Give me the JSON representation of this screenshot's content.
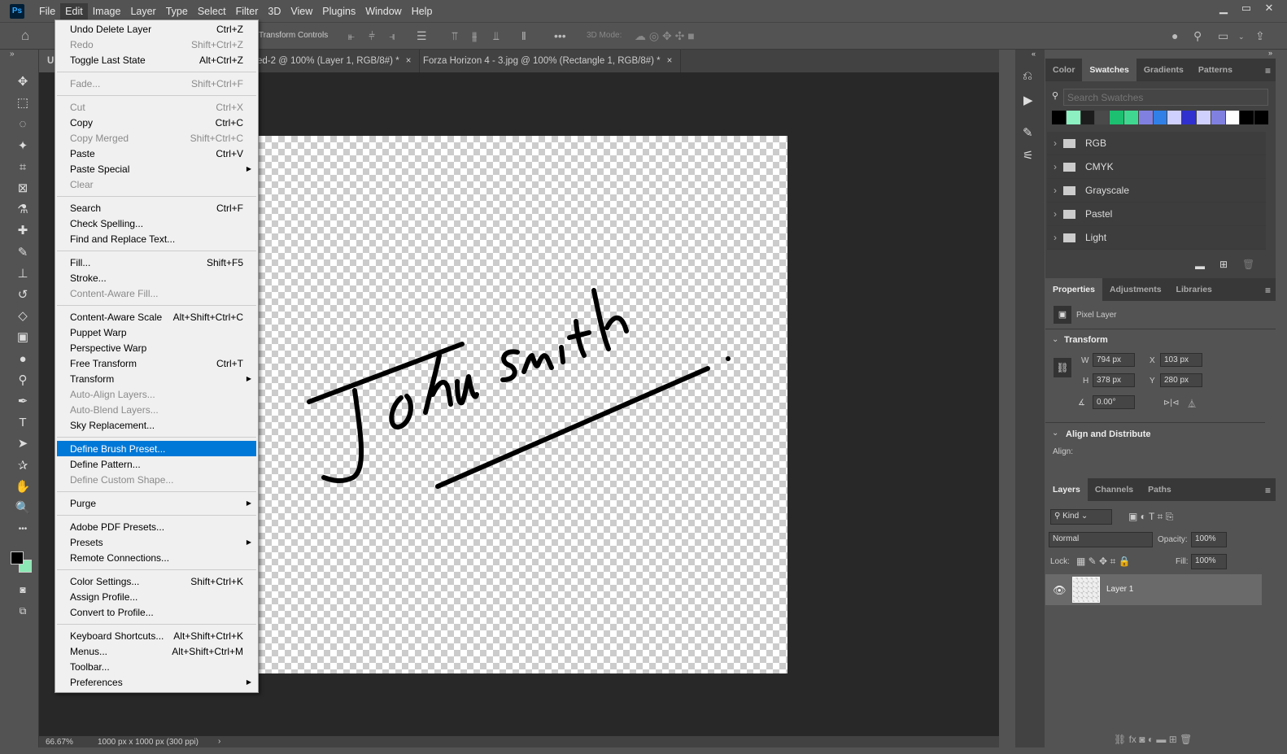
{
  "app": {
    "logo": "Ps"
  },
  "menubar": [
    "File",
    "Edit",
    "Image",
    "Layer",
    "Type",
    "Select",
    "Filter",
    "3D",
    "View",
    "Plugins",
    "Window",
    "Help"
  ],
  "active_menu": "Edit",
  "window_controls": [
    "minimize-icon",
    "maximize-icon",
    "close-icon"
  ],
  "options": {
    "transform_controls": "Transform Controls",
    "mode_3d": "3D Mode:"
  },
  "tabs": [
    {
      "label": "U",
      "partial": true
    },
    {
      "label": "ed-2 @ 100% (Layer 1, RGB/8#) *",
      "close": "×"
    },
    {
      "label": "Forza Horizon 4 - 3.jpg @ 100% (Rectangle 1, RGB/8#) *",
      "close": "×"
    }
  ],
  "edit_menu": [
    [
      {
        "label": "Undo Delete Layer",
        "shortcut": "Ctrl+Z"
      },
      {
        "label": "Redo",
        "shortcut": "Shift+Ctrl+Z",
        "disabled": true
      },
      {
        "label": "Toggle Last State",
        "shortcut": "Alt+Ctrl+Z"
      }
    ],
    [
      {
        "label": "Fade...",
        "shortcut": "Shift+Ctrl+F",
        "disabled": true
      }
    ],
    [
      {
        "label": "Cut",
        "shortcut": "Ctrl+X",
        "disabled": true
      },
      {
        "label": "Copy",
        "shortcut": "Ctrl+C"
      },
      {
        "label": "Copy Merged",
        "shortcut": "Shift+Ctrl+C",
        "disabled": true
      },
      {
        "label": "Paste",
        "shortcut": "Ctrl+V"
      },
      {
        "label": "Paste Special",
        "submenu": true
      },
      {
        "label": "Clear",
        "disabled": true
      }
    ],
    [
      {
        "label": "Search",
        "shortcut": "Ctrl+F"
      },
      {
        "label": "Check Spelling..."
      },
      {
        "label": "Find and Replace Text..."
      }
    ],
    [
      {
        "label": "Fill...",
        "shortcut": "Shift+F5"
      },
      {
        "label": "Stroke..."
      },
      {
        "label": "Content-Aware Fill...",
        "disabled": true
      }
    ],
    [
      {
        "label": "Content-Aware Scale",
        "shortcut": "Alt+Shift+Ctrl+C"
      },
      {
        "label": "Puppet Warp"
      },
      {
        "label": "Perspective Warp"
      },
      {
        "label": "Free Transform",
        "shortcut": "Ctrl+T"
      },
      {
        "label": "Transform",
        "submenu": true
      },
      {
        "label": "Auto-Align Layers...",
        "disabled": true
      },
      {
        "label": "Auto-Blend Layers...",
        "disabled": true
      },
      {
        "label": "Sky Replacement..."
      }
    ],
    [
      {
        "label": "Define Brush Preset...",
        "highlighted": true
      },
      {
        "label": "Define Pattern..."
      },
      {
        "label": "Define Custom Shape...",
        "disabled": true
      }
    ],
    [
      {
        "label": "Purge",
        "submenu": true
      }
    ],
    [
      {
        "label": "Adobe PDF Presets..."
      },
      {
        "label": "Presets",
        "submenu": true
      },
      {
        "label": "Remote Connections..."
      }
    ],
    [
      {
        "label": "Color Settings...",
        "shortcut": "Shift+Ctrl+K"
      },
      {
        "label": "Assign Profile..."
      },
      {
        "label": "Convert to Profile..."
      }
    ],
    [
      {
        "label": "Keyboard Shortcuts...",
        "shortcut": "Alt+Shift+Ctrl+K"
      },
      {
        "label": "Menus...",
        "shortcut": "Alt+Shift+Ctrl+M"
      },
      {
        "label": "Toolbar..."
      },
      {
        "label": "Preferences",
        "submenu": true
      }
    ]
  ],
  "tools": [
    "move-icon",
    "marquee-icon",
    "lasso-icon",
    "magic-wand-icon",
    "crop-icon",
    "frame-icon",
    "eyedropper-icon",
    "healing-icon",
    "brush-icon",
    "stamp-icon",
    "history-brush-icon",
    "eraser-icon",
    "gradient-icon",
    "blur-icon",
    "dodge-icon",
    "pen-icon",
    "type-icon",
    "path-select-icon",
    "shape-icon",
    "hand-icon",
    "zoom-icon",
    "more-icon"
  ],
  "colors": {
    "foreground": "#000000",
    "background": "#8ce8b4",
    "highlight": "#0078d7"
  },
  "status": {
    "zoom": "66.67%",
    "doc_info": "1000 px x 1000 px (300 ppi)"
  },
  "swatches_panel": {
    "tabs": [
      "Color",
      "Swatches",
      "Gradients",
      "Patterns"
    ],
    "active": "Swatches",
    "search_placeholder": "Search Swatches",
    "swatches": [
      "#000000",
      "#8cf0c0",
      "#1c1c1c",
      "#4a4a4a",
      "#1cc070",
      "#40d890",
      "#8080e0",
      "#3080e8",
      "#d0d0ff",
      "#3030d0",
      "#d0d0ff",
      "#8080e0",
      "#ffffff",
      "#000000",
      "#000000"
    ],
    "groups": [
      "RGB",
      "CMYK",
      "Grayscale",
      "Pastel",
      "Light"
    ]
  },
  "properties_panel": {
    "tabs": [
      "Properties",
      "Adjustments",
      "Libraries"
    ],
    "active": "Properties",
    "layer_type": "Pixel Layer",
    "transform_title": "Transform",
    "w_label": "W",
    "w": "794 px",
    "h_label": "H",
    "h": "378 px",
    "x_label": "X",
    "x": "103 px",
    "y_label": "Y",
    "y": "280 px",
    "angle": "0.00°",
    "align_title": "Align and Distribute",
    "align_label": "Align:"
  },
  "layers_panel": {
    "tabs": [
      "Layers",
      "Channels",
      "Paths"
    ],
    "active": "Layers",
    "filter": "Kind",
    "blend_mode": "Normal",
    "opacity_label": "Opacity:",
    "opacity": "100%",
    "lock_label": "Lock:",
    "fill_label": "Fill:",
    "fill": "100%",
    "layers": [
      {
        "name": "Layer 1",
        "visible": true,
        "selected": true
      }
    ]
  }
}
